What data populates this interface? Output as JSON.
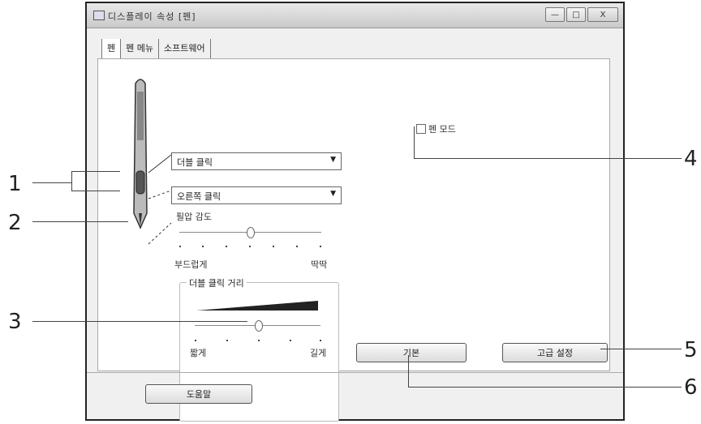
{
  "window": {
    "title": "디스플레이 속성 [펜]",
    "buttons": {
      "minimize": "—",
      "maximize": "□",
      "close": "X"
    }
  },
  "tabs": [
    {
      "label": "펜"
    },
    {
      "label": "펜 메뉴"
    },
    {
      "label": "소프트웨어"
    }
  ],
  "pen_settings": {
    "upper_button": "더블 클릭",
    "lower_button": "오른쪽 클릭",
    "tip_feel_label": "필압 감도",
    "tip_feel_left": "부드럽게",
    "tip_feel_right": "딱딱",
    "tip_feel_value": 0.5
  },
  "double_click_group": {
    "title": "더블 클릭 거리",
    "left_label": "짧게",
    "right_label": "길게",
    "value": 0.5
  },
  "checkbox": {
    "label": "펜 모드",
    "checked": false
  },
  "buttons": {
    "default": "기본",
    "advanced": "고급 설정",
    "help": "도움말"
  },
  "callouts": [
    "1",
    "2",
    "3",
    "4",
    "5",
    "6"
  ]
}
